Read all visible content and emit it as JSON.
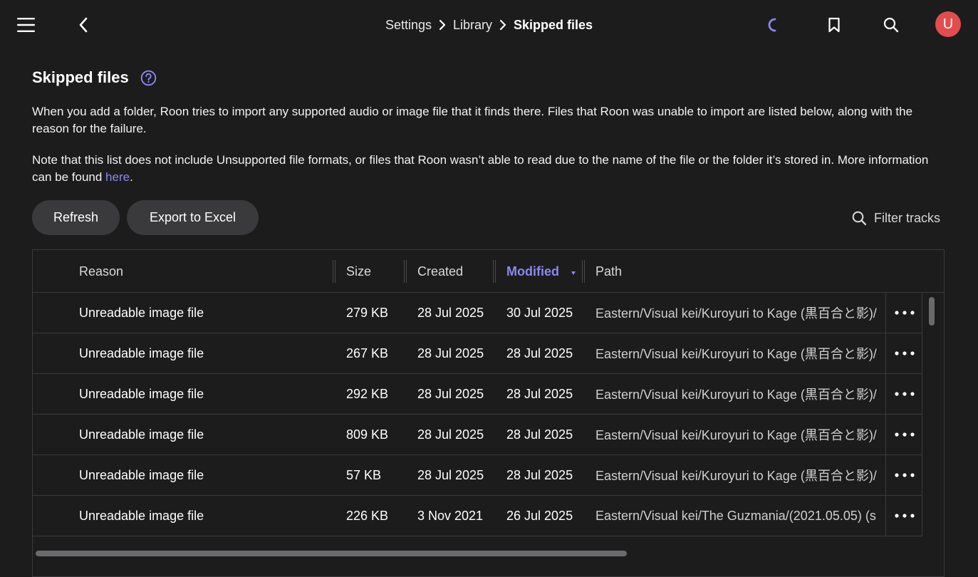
{
  "header": {
    "breadcrumb": [
      {
        "label": "Settings"
      },
      {
        "label": "Library"
      },
      {
        "label": "Skipped files"
      }
    ],
    "avatar_initial": "U"
  },
  "page": {
    "title": "Skipped files",
    "description_1": "When you add a folder, Roon tries to import any supported audio or image file that it finds there. Files that Roon was unable to import are listed below, along with the reason for the failure.",
    "description_2_prefix": "Note that this list does not include Unsupported file formats, or files that Roon wasn’t able to read due to the name of the file or the folder it’s stored in. More information can be found ",
    "description_2_link": "here",
    "description_2_suffix": "."
  },
  "toolbar": {
    "refresh_label": "Refresh",
    "export_label": "Export to Excel",
    "filter_placeholder": "Filter tracks"
  },
  "table": {
    "columns": [
      "Reason",
      "Size",
      "Created",
      "Modified",
      "Path"
    ],
    "sorted_column": "Modified",
    "rows": [
      {
        "reason": "Unreadable image file",
        "size": "279 KB",
        "created": "28 Jul 2025",
        "modified": "30 Jul 2025",
        "path": "Eastern/Visual kei/Kuroyuri to Kage (黒百合と影)/"
      },
      {
        "reason": "Unreadable image file",
        "size": "267 KB",
        "created": "28 Jul 2025",
        "modified": "28 Jul 2025",
        "path": "Eastern/Visual kei/Kuroyuri to Kage (黒百合と影)/"
      },
      {
        "reason": "Unreadable image file",
        "size": "292 KB",
        "created": "28 Jul 2025",
        "modified": "28 Jul 2025",
        "path": "Eastern/Visual kei/Kuroyuri to Kage (黒百合と影)/"
      },
      {
        "reason": "Unreadable image file",
        "size": "809 KB",
        "created": "28 Jul 2025",
        "modified": "28 Jul 2025",
        "path": "Eastern/Visual kei/Kuroyuri to Kage (黒百合と影)/"
      },
      {
        "reason": "Unreadable image file",
        "size": "57 KB",
        "created": "28 Jul 2025",
        "modified": "28 Jul 2025",
        "path": "Eastern/Visual kei/Kuroyuri to Kage (黒百合と影)/"
      },
      {
        "reason": "Unreadable image file",
        "size": "226 KB",
        "created": "3 Nov 2021",
        "modified": "26 Jul 2025",
        "path": "Eastern/Visual kei/The Guzmania/(2021.05.05) (s"
      }
    ]
  },
  "colors": {
    "accent": "#8c86f2",
    "avatar": "#e24d4d",
    "background": "#1c1c1d"
  }
}
